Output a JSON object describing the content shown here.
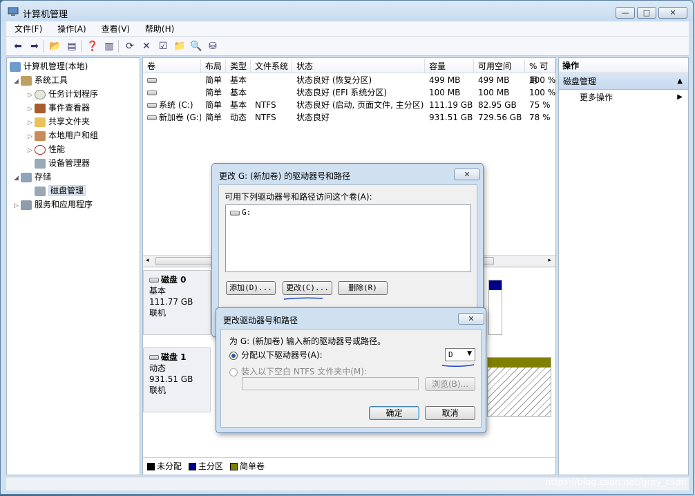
{
  "window": {
    "title": "计算机管理",
    "min": "—",
    "max": "□",
    "close": "✕"
  },
  "menu": [
    "文件(F)",
    "操作(A)",
    "查看(V)",
    "帮助(H)"
  ],
  "tree": {
    "root": "计算机管理(本地)",
    "items": [
      {
        "label": "系统工具",
        "level": 1,
        "expanded": true
      },
      {
        "label": "任务计划程序",
        "level": 2
      },
      {
        "label": "事件查看器",
        "level": 2
      },
      {
        "label": "共享文件夹",
        "level": 2
      },
      {
        "label": "本地用户和组",
        "level": 2
      },
      {
        "label": "性能",
        "level": 2
      },
      {
        "label": "设备管理器",
        "level": 2
      },
      {
        "label": "存储",
        "level": 1,
        "expanded": true
      },
      {
        "label": "磁盘管理",
        "level": 2,
        "selected": true
      },
      {
        "label": "服务和应用程序",
        "level": 1
      }
    ]
  },
  "volumes": {
    "columns": [
      "卷",
      "布局",
      "类型",
      "文件系统",
      "状态",
      "容量",
      "可用空间",
      "% 可用"
    ],
    "rows": [
      [
        "",
        "简单",
        "基本",
        "",
        "状态良好 (恢复分区)",
        "499 MB",
        "499 MB",
        "100 %"
      ],
      [
        "",
        "简单",
        "基本",
        "",
        "状态良好 (EFI 系统分区)",
        "100 MB",
        "100 MB",
        "100 %"
      ],
      [
        "系统 (C:)",
        "简单",
        "基本",
        "NTFS",
        "状态良好 (启动, 页面文件, 主分区)",
        "111.19 GB",
        "82.95 GB",
        "75 %"
      ],
      [
        "新加卷 (G:)",
        "简单",
        "动态",
        "NTFS",
        "状态良好",
        "931.51 GB",
        "729.56 GB",
        "78 %"
      ]
    ]
  },
  "disks": [
    {
      "name": "磁盘 0",
      "type": "基本",
      "size": "111.77 GB",
      "status": "联机"
    },
    {
      "name": "磁盘 1",
      "type": "动态",
      "size": "931.51 GB",
      "status": "联机"
    }
  ],
  "legend": [
    {
      "label": "未分配",
      "color": "#000000"
    },
    {
      "label": "主分区",
      "color": "#00008b"
    },
    {
      "label": "简单卷",
      "color": "#808000"
    }
  ],
  "actions": {
    "header": "操作",
    "section": "磁盘管理",
    "more": "更多操作"
  },
  "dialog1": {
    "title": "更改 G: (新加卷) 的驱动器号和路径",
    "close": "✕",
    "prompt": "可用下列驱动器号和路径访问这个卷(A):",
    "list": [
      "G:"
    ],
    "add": "添加(D)...",
    "change": "更改(C)...",
    "remove": "删除(R)"
  },
  "dialog2": {
    "title": "更改驱动器号和路径",
    "close": "✕",
    "prompt": "为 G: (新加卷) 输入新的驱动器号或路径。",
    "assign": "分配以下驱动器号(A):",
    "drive": "D",
    "mount": "装入以下空白 NTFS 文件夹中(M):",
    "browse": "浏览(B)...",
    "ok": "确定",
    "cancel": "取消"
  },
  "watermark": "https://blog.csdn.net/grey_csdn"
}
